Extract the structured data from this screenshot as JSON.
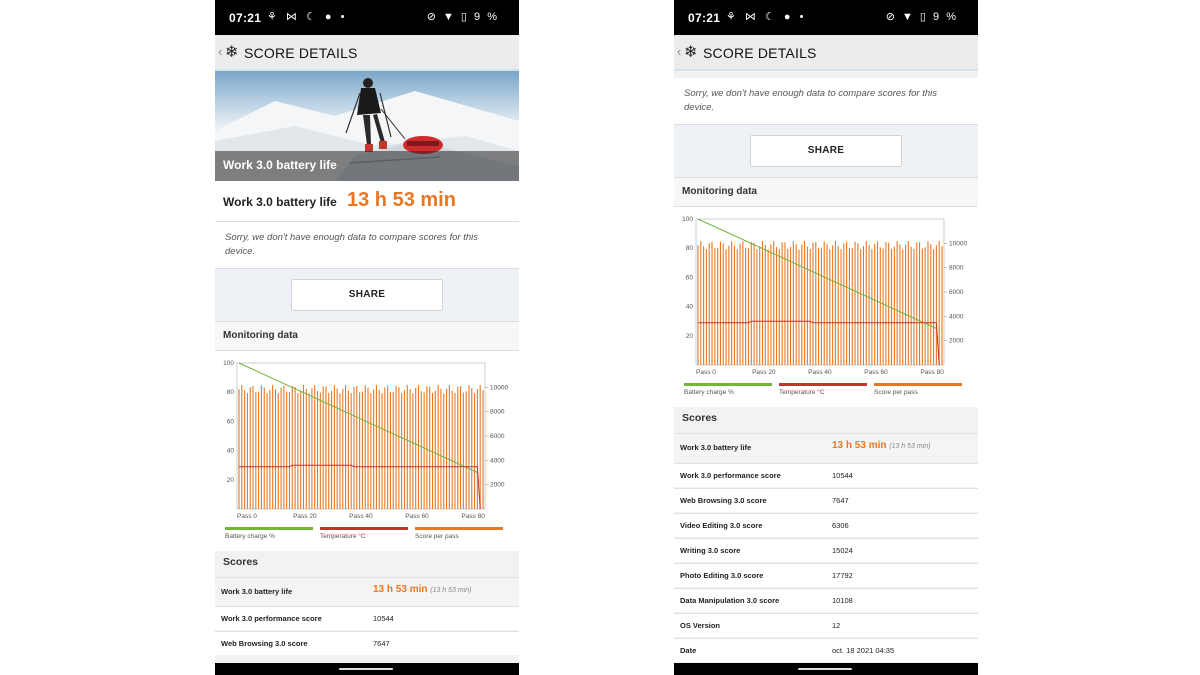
{
  "status_bar": {
    "time": "07:21",
    "left_icons": "⚘ ⋈ ☾ ● •",
    "right_icons": "⊘ ▼ ▯ 9 %"
  },
  "app_bar": {
    "back": "‹",
    "logo": "❄",
    "title": "SCORE DETAILS"
  },
  "hero": {
    "label": "Work 3.0 battery life"
  },
  "result": {
    "label": "Work 3.0 battery life",
    "value": "13 h 53 min"
  },
  "compare_message": "Sorry, we don't have enough data to compare scores for this device.",
  "share_label": "SHARE",
  "monitoring_title": "Monitoring data",
  "scores_title": "Scores",
  "colors": {
    "accent": "#e87722",
    "battery": "#71b53a",
    "temperature": "#c8322a",
    "score": "#e87722"
  },
  "scores": [
    {
      "label": "Work 3.0 battery life",
      "value": "13 h 53 min",
      "sub": "(13 h 53 min)"
    },
    {
      "label": "Work 3.0 performance score",
      "value": "10544"
    },
    {
      "label": "Web Browsing 3.0 score",
      "value": "7647"
    },
    {
      "label": "Video Editing 3.0 score",
      "value": "6306"
    },
    {
      "label": "Writing 3.0 score",
      "value": "15024"
    },
    {
      "label": "Photo Editing 3.0 score",
      "value": "17792"
    },
    {
      "label": "Data Manipulation 3.0 score",
      "value": "10108"
    },
    {
      "label": "OS Version",
      "value": "12"
    },
    {
      "label": "Date",
      "value": "oct. 18 2021 04:35"
    }
  ],
  "chart_data": {
    "type": "line",
    "x": [
      "Pass 0",
      "Pass 20",
      "Pass 40",
      "Pass 60",
      "Pass 80"
    ],
    "y_left_ticks": [
      "100",
      "80",
      "60",
      "40",
      "20"
    ],
    "y_right_ticks": [
      "10000",
      "8000",
      "6000",
      "4000",
      "2000"
    ],
    "ylim_left": [
      0,
      100
    ],
    "ylim_right": [
      0,
      12000
    ],
    "passes": 88,
    "series": [
      {
        "name": "Battery charge %",
        "color": "#71b53a",
        "x": [
          0,
          85
        ],
        "values": [
          100,
          25
        ]
      },
      {
        "name": "Temperature °C",
        "color": "#c8322a",
        "x": [
          0,
          18,
          19,
          40,
          41,
          85,
          86
        ],
        "values": [
          29,
          29,
          30,
          30,
          29,
          29,
          0
        ]
      },
      {
        "name": "Score per pass",
        "color": "#e87722",
        "typical": 9700,
        "range": [
          9500,
          10200
        ]
      }
    ]
  }
}
